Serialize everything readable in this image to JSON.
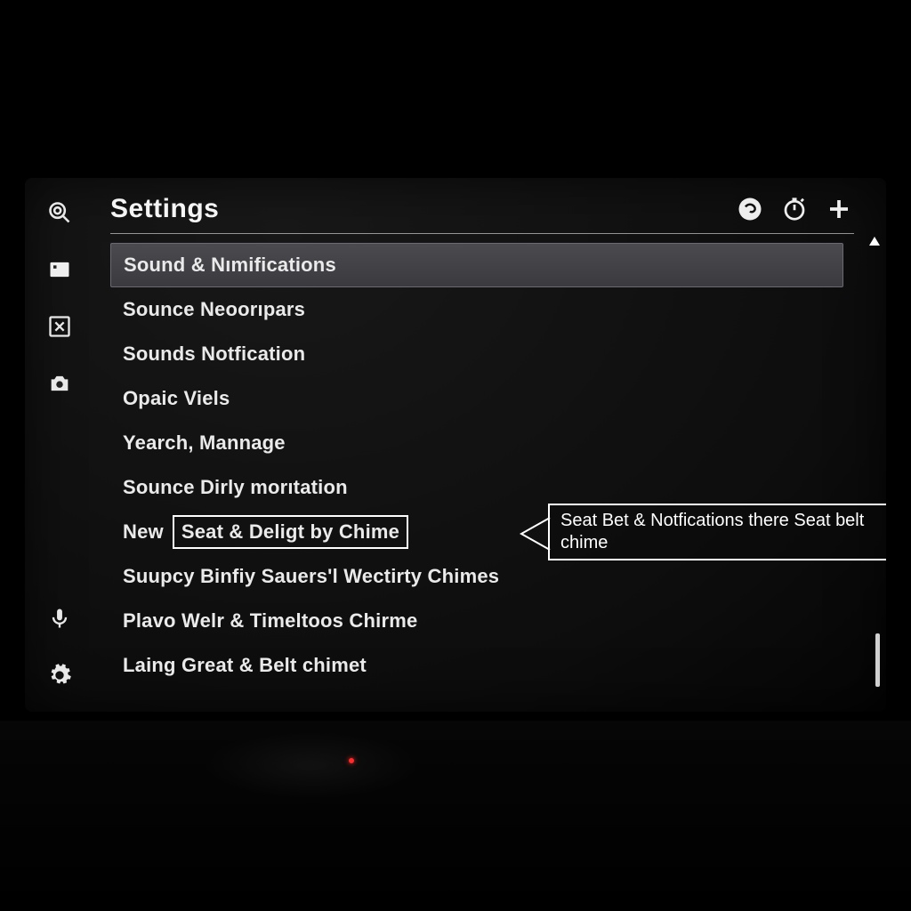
{
  "header": {
    "title": "Settings"
  },
  "sidebar": {
    "icons": [
      "search-icon",
      "home-icon",
      "apps-icon",
      "camera-icon",
      "mic-icon",
      "gear-icon"
    ]
  },
  "header_icons": [
    "chat-icon",
    "timer-icon",
    "plus-icon"
  ],
  "list": {
    "items": [
      {
        "label": "Sound & Nımifications",
        "selected": true
      },
      {
        "label": "Sounce Neoorıpars"
      },
      {
        "label": "Sounds Notfication"
      },
      {
        "label": "Opaic Viels"
      },
      {
        "label": "Yearch, Mannage"
      },
      {
        "label": "Sounce Dirly morıtation"
      },
      {
        "prefix": "New",
        "boxed": "Seat & Deligt by Chime"
      },
      {
        "label": "Suupcy Binfiy Sauers'l Wectirty Chimes"
      },
      {
        "label": "Plavo Welr & Timeltoos Chirme"
      },
      {
        "label": "Laing Great & Belt chimet"
      }
    ]
  },
  "callout": {
    "text": "Seat Bet & Notfications there Seat belt chime"
  }
}
